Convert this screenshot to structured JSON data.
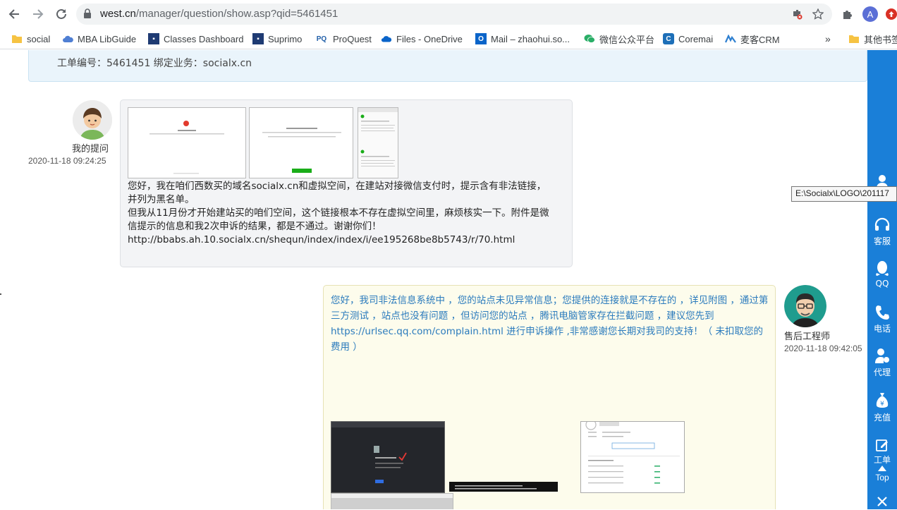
{
  "browser": {
    "url_host": "west.cn",
    "url_path": "/manager/question/show.asp?qid=5461451",
    "profile_initial": "A"
  },
  "bookmarks": [
    {
      "label": "social",
      "icon": "folder-icon"
    },
    {
      "label": "MBA LibGuide",
      "icon": "cloud-icon"
    },
    {
      "label": "Classes Dashboard",
      "icon": "dashboard-icon"
    },
    {
      "label": "Suprimo",
      "icon": "suprimo-icon"
    },
    {
      "label": "ProQuest",
      "icon": "pq-icon"
    },
    {
      "label": "Files - OneDrive",
      "icon": "onedrive-icon"
    },
    {
      "label": "Mail – zhaohui.so...",
      "icon": "outlook-icon"
    },
    {
      "label": "微信公众平台",
      "icon": "wechat-icon"
    },
    {
      "label": "Coremai",
      "icon": "c-icon"
    },
    {
      "label": "麦客CRM",
      "icon": "mike-icon"
    },
    {
      "label": "其他书签",
      "icon": "folder-icon"
    }
  ],
  "ticket": {
    "info": "工单编号：5461451  绑定业务：socialx.cn"
  },
  "question": {
    "author": "我的提问",
    "time": "2020-11-18 09:24:25",
    "lines": [
      "您好，我在咱们西数买的域名socialx.cn和虚拟空间，在建站对接微信支付时，提示含有非法链接，",
      "并列为黑名单。",
      "但我从11月份才开始建站买的咱们空间，这个链接根本不存在虚拟空间里，麻烦核实一下。附件是微",
      "信提示的信息和我2次申诉的结果，都是不通过。谢谢你们！",
      "http://bbabs.ah.10.socialx.cn/shequn/index/index/i/ee195268be8b5743/r/70.html"
    ]
  },
  "answer": {
    "author": "售后工程师",
    "time": "2020-11-18 09:42:05",
    "text": "您好，我司非法信息系统中 ，您的站点未见异常信息；您提供的连接就是不存在的 ，详见附图 ，通过第三方测试 ，站点也没有问题 ，但访问您的站点 ，腾讯电脑管家存在拦截问题 ，建议您先到 https://urlsec.qq.com/complain.html  进行申诉操作 ,非常感谢您长期对我司的支持！（ 未扣取您的费用 ）"
  },
  "sidebar": {
    "items": [
      "客服",
      "QQ",
      "电话",
      "代理",
      "充值",
      "工单"
    ],
    "top_label": "Top"
  },
  "tooltip": "E:\\Socialx\\LOGO\\201117"
}
